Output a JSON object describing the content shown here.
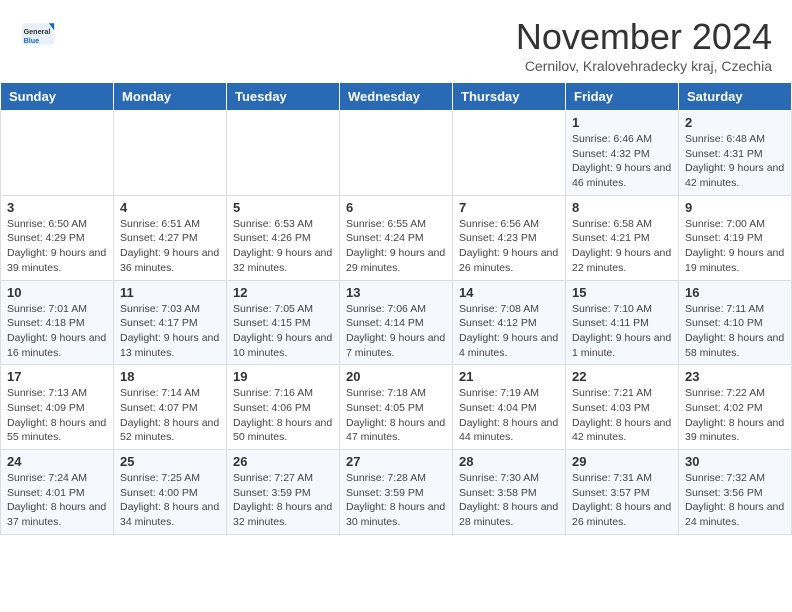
{
  "logo": {
    "general": "General",
    "blue": "Blue"
  },
  "header": {
    "month": "November 2024",
    "location": "Cernilov, Kralovehradecky kraj, Czechia"
  },
  "weekdays": [
    "Sunday",
    "Monday",
    "Tuesday",
    "Wednesday",
    "Thursday",
    "Friday",
    "Saturday"
  ],
  "weeks": [
    [
      {
        "day": "",
        "info": ""
      },
      {
        "day": "",
        "info": ""
      },
      {
        "day": "",
        "info": ""
      },
      {
        "day": "",
        "info": ""
      },
      {
        "day": "",
        "info": ""
      },
      {
        "day": "1",
        "info": "Sunrise: 6:46 AM\nSunset: 4:32 PM\nDaylight: 9 hours and 46 minutes."
      },
      {
        "day": "2",
        "info": "Sunrise: 6:48 AM\nSunset: 4:31 PM\nDaylight: 9 hours and 42 minutes."
      }
    ],
    [
      {
        "day": "3",
        "info": "Sunrise: 6:50 AM\nSunset: 4:29 PM\nDaylight: 9 hours and 39 minutes."
      },
      {
        "day": "4",
        "info": "Sunrise: 6:51 AM\nSunset: 4:27 PM\nDaylight: 9 hours and 36 minutes."
      },
      {
        "day": "5",
        "info": "Sunrise: 6:53 AM\nSunset: 4:26 PM\nDaylight: 9 hours and 32 minutes."
      },
      {
        "day": "6",
        "info": "Sunrise: 6:55 AM\nSunset: 4:24 PM\nDaylight: 9 hours and 29 minutes."
      },
      {
        "day": "7",
        "info": "Sunrise: 6:56 AM\nSunset: 4:23 PM\nDaylight: 9 hours and 26 minutes."
      },
      {
        "day": "8",
        "info": "Sunrise: 6:58 AM\nSunset: 4:21 PM\nDaylight: 9 hours and 22 minutes."
      },
      {
        "day": "9",
        "info": "Sunrise: 7:00 AM\nSunset: 4:19 PM\nDaylight: 9 hours and 19 minutes."
      }
    ],
    [
      {
        "day": "10",
        "info": "Sunrise: 7:01 AM\nSunset: 4:18 PM\nDaylight: 9 hours and 16 minutes."
      },
      {
        "day": "11",
        "info": "Sunrise: 7:03 AM\nSunset: 4:17 PM\nDaylight: 9 hours and 13 minutes."
      },
      {
        "day": "12",
        "info": "Sunrise: 7:05 AM\nSunset: 4:15 PM\nDaylight: 9 hours and 10 minutes."
      },
      {
        "day": "13",
        "info": "Sunrise: 7:06 AM\nSunset: 4:14 PM\nDaylight: 9 hours and 7 minutes."
      },
      {
        "day": "14",
        "info": "Sunrise: 7:08 AM\nSunset: 4:12 PM\nDaylight: 9 hours and 4 minutes."
      },
      {
        "day": "15",
        "info": "Sunrise: 7:10 AM\nSunset: 4:11 PM\nDaylight: 9 hours and 1 minute."
      },
      {
        "day": "16",
        "info": "Sunrise: 7:11 AM\nSunset: 4:10 PM\nDaylight: 8 hours and 58 minutes."
      }
    ],
    [
      {
        "day": "17",
        "info": "Sunrise: 7:13 AM\nSunset: 4:09 PM\nDaylight: 8 hours and 55 minutes."
      },
      {
        "day": "18",
        "info": "Sunrise: 7:14 AM\nSunset: 4:07 PM\nDaylight: 8 hours and 52 minutes."
      },
      {
        "day": "19",
        "info": "Sunrise: 7:16 AM\nSunset: 4:06 PM\nDaylight: 8 hours and 50 minutes."
      },
      {
        "day": "20",
        "info": "Sunrise: 7:18 AM\nSunset: 4:05 PM\nDaylight: 8 hours and 47 minutes."
      },
      {
        "day": "21",
        "info": "Sunrise: 7:19 AM\nSunset: 4:04 PM\nDaylight: 8 hours and 44 minutes."
      },
      {
        "day": "22",
        "info": "Sunrise: 7:21 AM\nSunset: 4:03 PM\nDaylight: 8 hours and 42 minutes."
      },
      {
        "day": "23",
        "info": "Sunrise: 7:22 AM\nSunset: 4:02 PM\nDaylight: 8 hours and 39 minutes."
      }
    ],
    [
      {
        "day": "24",
        "info": "Sunrise: 7:24 AM\nSunset: 4:01 PM\nDaylight: 8 hours and 37 minutes."
      },
      {
        "day": "25",
        "info": "Sunrise: 7:25 AM\nSunset: 4:00 PM\nDaylight: 8 hours and 34 minutes."
      },
      {
        "day": "26",
        "info": "Sunrise: 7:27 AM\nSunset: 3:59 PM\nDaylight: 8 hours and 32 minutes."
      },
      {
        "day": "27",
        "info": "Sunrise: 7:28 AM\nSunset: 3:59 PM\nDaylight: 8 hours and 30 minutes."
      },
      {
        "day": "28",
        "info": "Sunrise: 7:30 AM\nSunset: 3:58 PM\nDaylight: 8 hours and 28 minutes."
      },
      {
        "day": "29",
        "info": "Sunrise: 7:31 AM\nSunset: 3:57 PM\nDaylight: 8 hours and 26 minutes."
      },
      {
        "day": "30",
        "info": "Sunrise: 7:32 AM\nSunset: 3:56 PM\nDaylight: 8 hours and 24 minutes."
      }
    ]
  ]
}
